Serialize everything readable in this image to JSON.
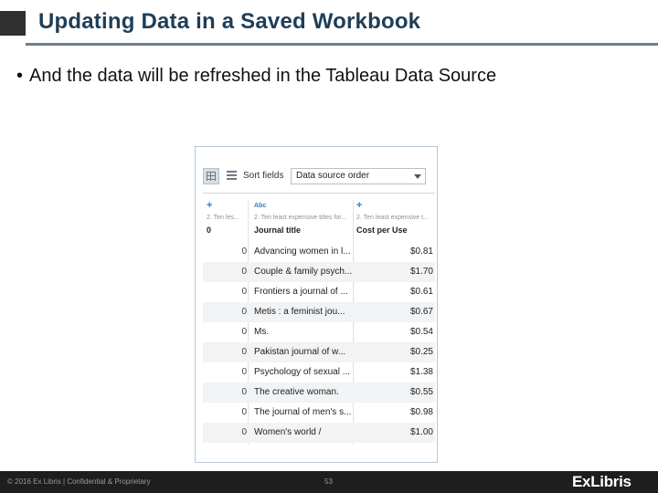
{
  "slide": {
    "title": "Updating Data in a Saved Workbook",
    "bullet": "And the data will be refreshed in the Tableau Data Source"
  },
  "toolbar": {
    "sort_label": "Sort fields",
    "sort_value": "Data source order"
  },
  "columns": [
    {
      "type_icon": "+",
      "source": "2. Ten les...",
      "name": "0"
    },
    {
      "type_icon": "Abc",
      "source": "2. Ten least expensive titles for...",
      "name": "Journal title"
    },
    {
      "type_icon": "+",
      "source": "2. Ten least expensive t...",
      "name": "Cost per Use"
    }
  ],
  "rows": [
    {
      "c0": "0",
      "c1": "Advancing women in l...",
      "c2": "$0.81"
    },
    {
      "c0": "0",
      "c1": "Couple & family psych...",
      "c2": "$1.70"
    },
    {
      "c0": "0",
      "c1": "Frontiers a journal of ...",
      "c2": "$0.61"
    },
    {
      "c0": "0",
      "c1": "Metis : a feminist jou...",
      "c2": "$0.67"
    },
    {
      "c0": "0",
      "c1": "Ms.",
      "c2": "$0.54"
    },
    {
      "c0": "0",
      "c1": "Pakistan journal of w...",
      "c2": "$0.25"
    },
    {
      "c0": "0",
      "c1": "Psychology of sexual ...",
      "c2": "$1.38"
    },
    {
      "c0": "0",
      "c1": "The creative woman.",
      "c2": "$0.55"
    },
    {
      "c0": "0",
      "c1": "The journal of men's s...",
      "c2": "$0.98"
    },
    {
      "c0": "0",
      "c1": "Women's world /",
      "c2": "$1.00"
    }
  ],
  "footer": {
    "copyright": "© 2016 Ex Libris | Confidential & Proprietary",
    "page": "53",
    "logo": "ExLibris"
  },
  "colors": {
    "title": "#1f3e57",
    "footer_bg": "#1e1e1e",
    "row_alt": "#f1f3f5",
    "type_icon": "#3a7bb8"
  }
}
